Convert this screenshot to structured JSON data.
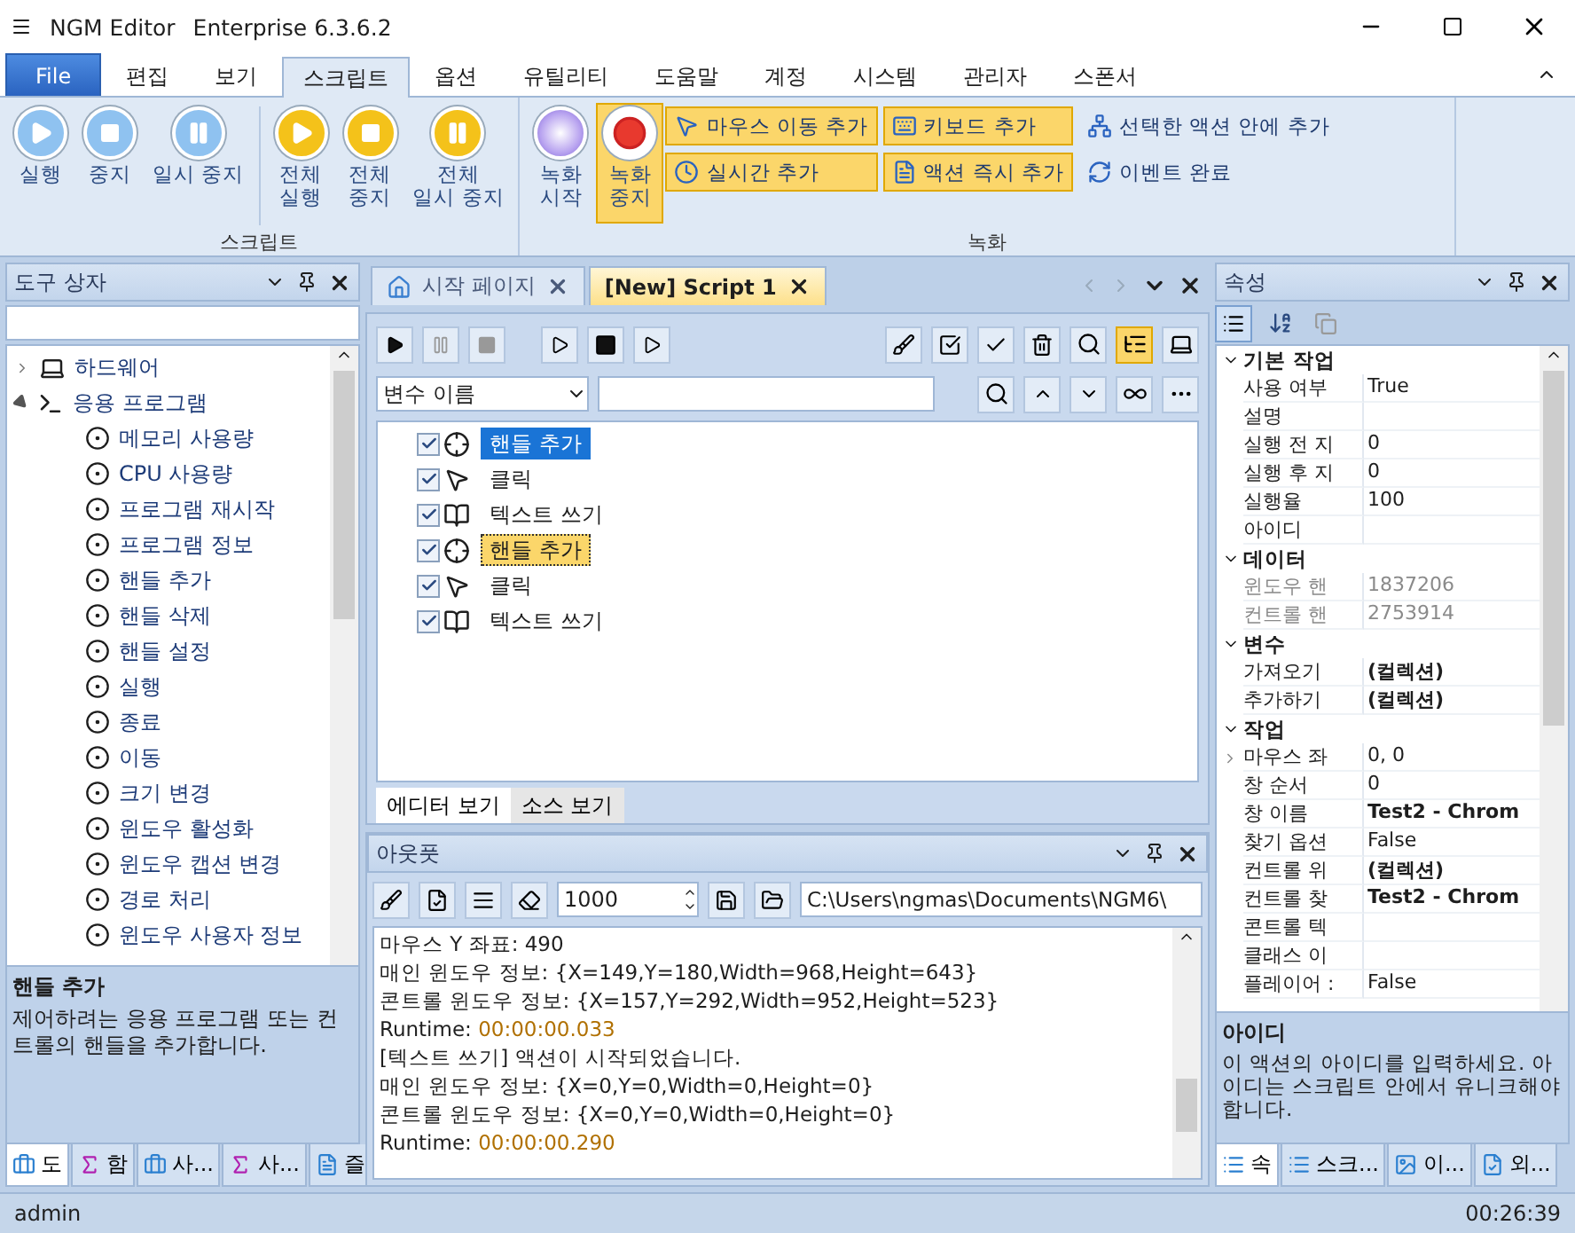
{
  "window": {
    "title": "NGM Editor",
    "edition": "Enterprise 6.3.6.2"
  },
  "menu_tabs": [
    {
      "label": "File",
      "kind": "file",
      "selected": false
    },
    {
      "label": "편집",
      "kind": "tab",
      "selected": false
    },
    {
      "label": "보기",
      "kind": "tab",
      "selected": false
    },
    {
      "label": "스크립트",
      "kind": "tab",
      "selected": true
    },
    {
      "label": "옵션",
      "kind": "tab",
      "selected": false
    },
    {
      "label": "유틸리티",
      "kind": "tab",
      "selected": false
    },
    {
      "label": "도움말",
      "kind": "tab",
      "selected": false
    },
    {
      "label": "계정",
      "kind": "tab",
      "selected": false
    },
    {
      "label": "시스템",
      "kind": "tab",
      "selected": false
    },
    {
      "label": "관리자",
      "kind": "tab",
      "selected": false
    },
    {
      "label": "스폰서",
      "kind": "tab",
      "selected": false
    }
  ],
  "ribbon": [
    {
      "title": "스크립트",
      "large_buttons": [
        {
          "label": "실행",
          "kind": "play",
          "color": "#8fc2f0",
          "selected": false
        },
        {
          "label": "중지",
          "kind": "stop",
          "color": "#8fc2f0",
          "selected": false
        },
        {
          "label": "일시 중지",
          "kind": "pause",
          "color": "#8fc2f0",
          "selected": false
        },
        {
          "label": "전체\n실행",
          "kind": "play",
          "color": "#f4c21a",
          "selected": false
        },
        {
          "label": "전체\n중지",
          "kind": "stop",
          "color": "#f4c21a",
          "selected": false
        },
        {
          "label": "전체\n일시 중지",
          "kind": "pause",
          "color": "#f4c21a",
          "selected": false
        }
      ]
    },
    {
      "title": "녹화",
      "large_buttons": [
        {
          "label": "녹화\n시작",
          "kind": "record-start",
          "selected": false
        },
        {
          "label": "녹화\n중지",
          "kind": "record-stop",
          "selected": true
        }
      ],
      "small_buttons": [
        {
          "label": "마우스 이동 추가",
          "kind": "mouse",
          "on": true
        },
        {
          "label": "키보드 추가",
          "kind": "keyboard",
          "on": true
        },
        {
          "label": "선택한 액션 안에 추가",
          "kind": "tree",
          "on": false
        },
        {
          "label": "실시간 추가",
          "kind": "clock",
          "on": true
        },
        {
          "label": "액션 즉시 추가",
          "kind": "action",
          "on": true
        },
        {
          "label": "이벤트 완료",
          "kind": "refresh",
          "on": false
        }
      ]
    }
  ],
  "toolbox": {
    "title": "도구 상자",
    "tree": [
      {
        "label": "하드웨어",
        "kind": "device",
        "expanded": false
      },
      {
        "label": "응용 프로그램",
        "kind": "app",
        "expanded": true,
        "children": [
          {
            "label": "메모리 사용량"
          },
          {
            "label": "CPU 사용량"
          },
          {
            "label": "프로그램 재시작"
          },
          {
            "label": "프로그램 정보"
          },
          {
            "label": "핸들 추가"
          },
          {
            "label": "핸들 삭제"
          },
          {
            "label": "핸들 설정"
          },
          {
            "label": "실행"
          },
          {
            "label": "종료"
          },
          {
            "label": "이동"
          },
          {
            "label": "크기 변경"
          },
          {
            "label": "윈도우 활성화"
          },
          {
            "label": "윈도우 캡션 변경"
          },
          {
            "label": "경로 처리"
          },
          {
            "label": "윈도우 사용자 정보"
          }
        ]
      }
    ],
    "description": {
      "title": "핸들 추가",
      "text": "제어하려는 응용 프로그램 또는 컨트롤의 핸들을 추가합니다."
    },
    "tabs": [
      {
        "label": "도",
        "kind": "toolbox",
        "selected": true
      },
      {
        "label": "함",
        "kind": "function",
        "selected": false
      },
      {
        "label": "사...",
        "kind": "toolbox",
        "selected": false
      },
      {
        "label": "사...",
        "kind": "function",
        "selected": false
      },
      {
        "label": "즐",
        "kind": "document",
        "selected": false
      }
    ]
  },
  "editor": {
    "doc_tabs": [
      {
        "label": "시작 페이지",
        "kind": "home",
        "selected": false
      },
      {
        "label": "[New] Script 1",
        "kind": "script",
        "selected": true
      }
    ],
    "tree_view": {
      "on": true
    },
    "filter": {
      "dropdown": "변수 이름"
    },
    "actions": [
      {
        "label": "핸들 추가",
        "kind": "handle",
        "checked": true,
        "selected": true,
        "focused": false
      },
      {
        "label": "클릭",
        "kind": "click",
        "checked": true,
        "selected": false,
        "focused": false
      },
      {
        "label": "텍스트 쓰기",
        "kind": "text",
        "checked": true,
        "selected": false,
        "focused": false
      },
      {
        "label": "핸들 추가",
        "kind": "handle",
        "checked": true,
        "selected": false,
        "focused": true
      },
      {
        "label": "클릭",
        "kind": "click",
        "checked": true,
        "selected": false,
        "focused": false
      },
      {
        "label": "텍스트 쓰기",
        "kind": "text",
        "checked": true,
        "selected": false,
        "focused": false
      }
    ],
    "view_tabs": [
      {
        "label": "에디터 보기",
        "selected": true
      },
      {
        "label": "소스 보기",
        "selected": false
      }
    ]
  },
  "output": {
    "title": "아웃풋",
    "max_lines": "1000",
    "log_path": "C:\\Users\\ngmas\\Documents\\NGM6\\",
    "lines": [
      {
        "kind": "info",
        "text": "마우스 Y 좌표: 490"
      },
      {
        "kind": "info",
        "text": "매인 윈도우 정보: {X=149,Y=180,Width=968,Height=643}"
      },
      {
        "kind": "info",
        "text": "콘트롤 윈도우 정보: {X=157,Y=292,Width=952,Height=523}"
      },
      {
        "kind": "runtime",
        "label": "Runtime:",
        "value": "00:00:00.033"
      },
      {
        "kind": "info",
        "text": "[텍스트 쓰기] 액션이 시작되었습니다."
      },
      {
        "kind": "info",
        "text": "매인 윈도우 정보: {X=0,Y=0,Width=0,Height=0}"
      },
      {
        "kind": "info",
        "text": "콘트롤 윈도우 정보: {X=0,Y=0,Width=0,Height=0}"
      },
      {
        "kind": "runtime",
        "label": "Runtime:",
        "value": "00:00:00.290"
      }
    ]
  },
  "properties": {
    "title": "속성",
    "categories": [
      {
        "name": "기본 작업",
        "expanded": true,
        "rows": [
          {
            "name": "사용 여부",
            "value": "True",
            "bold": false,
            "disabled": false
          },
          {
            "name": "설명",
            "bold": false,
            "disabled": false
          },
          {
            "name": "실행 전 지",
            "value": "0",
            "bold": false,
            "disabled": false
          },
          {
            "name": "실행 후 지",
            "value": "0",
            "bold": false,
            "disabled": false
          },
          {
            "name": "실행율",
            "value": "100",
            "bold": false,
            "disabled": false
          },
          {
            "name": "아이디",
            "bold": false,
            "disabled": false
          }
        ]
      },
      {
        "name": "데이터",
        "expanded": true,
        "rows": [
          {
            "name": "윈도우 핸",
            "value": "1837206",
            "bold": false,
            "disabled": true
          },
          {
            "name": "컨트롤 핸",
            "value": "2753914",
            "bold": false,
            "disabled": true
          }
        ]
      },
      {
        "name": "변수",
        "expanded": true,
        "rows": [
          {
            "name": "가져오기",
            "value": "(컬렉션)",
            "bold": true,
            "disabled": false
          },
          {
            "name": "추가하기",
            "value": "(컬렉션)",
            "bold": true,
            "disabled": false
          }
        ]
      },
      {
        "name": "작업",
        "expanded": true,
        "rows": [
          {
            "name": "마우스 좌",
            "value": "0, 0",
            "bold": false,
            "disabled": false,
            "expanded": false
          },
          {
            "name": "창 순서",
            "value": "0",
            "bold": false,
            "disabled": false
          },
          {
            "name": "창 이름",
            "value": "Test2 - Chrom",
            "bold": true,
            "disabled": false
          },
          {
            "name": "찾기 옵션",
            "value": "False",
            "bold": false,
            "disabled": false
          },
          {
            "name": "컨트롤 위",
            "value": "(컬렉션)",
            "bold": true,
            "disabled": false
          },
          {
            "name": "컨트롤 찾",
            "value": "Test2 - Chrom",
            "bold": true,
            "disabled": false
          },
          {
            "name": "콘트롤 텍",
            "bold": false,
            "disabled": false
          },
          {
            "name": "클래스 이",
            "bold": false,
            "disabled": false
          },
          {
            "name": "플레이어 :",
            "value": "False",
            "bold": false,
            "disabled": false
          }
        ]
      }
    ],
    "description": {
      "title": "아이디",
      "text": "이 액션의 아이디를 입력하세요. 아이디는 스크립트 안에서 유니크해야 합니다."
    },
    "tabs": [
      {
        "label": "속",
        "kind": "props",
        "selected": true
      },
      {
        "label": "스크...",
        "kind": "props",
        "selected": false
      },
      {
        "label": "이...",
        "kind": "image",
        "selected": false
      },
      {
        "label": "외...",
        "kind": "api",
        "selected": false
      }
    ]
  },
  "status": {
    "user": "admin",
    "time": "00:26:39"
  }
}
